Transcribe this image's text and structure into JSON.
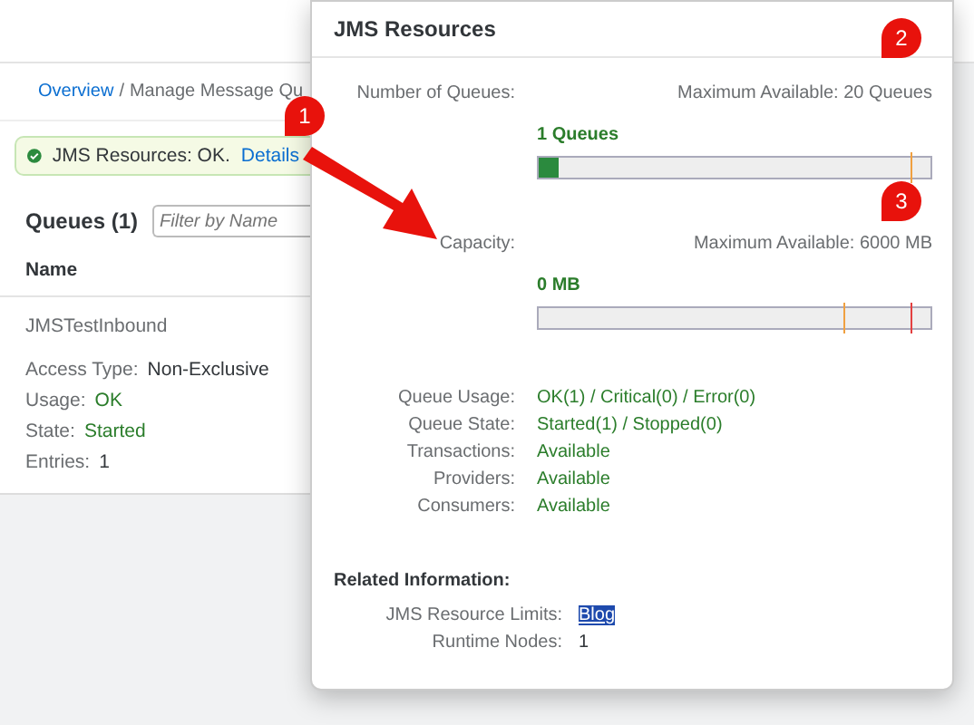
{
  "breadcrumb": {
    "links": [
      "Overview"
    ],
    "separator": "/",
    "current": "Manage Message Qu"
  },
  "status_strip": {
    "text": "JMS Resources: OK.",
    "link": "Details"
  },
  "queues": {
    "title": "Queues (1)",
    "filter": {
      "placeholder": "Filter by Name"
    },
    "column": "Name",
    "item": {
      "name": "JMSTestInbound",
      "fields": [
        {
          "label": "Access Type:",
          "value": "Non-Exclusive",
          "kind": "plain"
        },
        {
          "label": "Usage:",
          "value": "OK",
          "kind": "good"
        },
        {
          "label": "State:",
          "value": "Started",
          "kind": "good"
        },
        {
          "label": "Entries:",
          "value": "1",
          "kind": "plain"
        }
      ]
    }
  },
  "popover": {
    "title": "JMS Resources",
    "meters": [
      {
        "label": "Number of Queues:",
        "maximum": "Maximum Available: 20 Queues",
        "reading": "1 Queues",
        "level": 0.05
      },
      {
        "label": "Capacity:",
        "maximum": "Maximum Available: 6000 MB",
        "reading": "0 MB"
      }
    ],
    "details": [
      {
        "label": "Queue Usage:",
        "value": "OK(1) / Critical(0) / Error(0)"
      },
      {
        "label": "Queue State:",
        "value": "Started(1) / Stopped(0)"
      },
      {
        "label": "Transactions:",
        "value": "Available"
      },
      {
        "label": "Providers:",
        "value": "Available"
      },
      {
        "label": "Consumers:",
        "value": "Available"
      }
    ],
    "related": {
      "title": "Related Information:",
      "items": [
        {
          "label": "JMS Resource Limits:",
          "value": "Blog",
          "kind": "link"
        },
        {
          "label": "Runtime Nodes:",
          "value": "1",
          "kind": "plain"
        }
      ]
    }
  },
  "callouts": [
    "1",
    "2",
    "3"
  ]
}
